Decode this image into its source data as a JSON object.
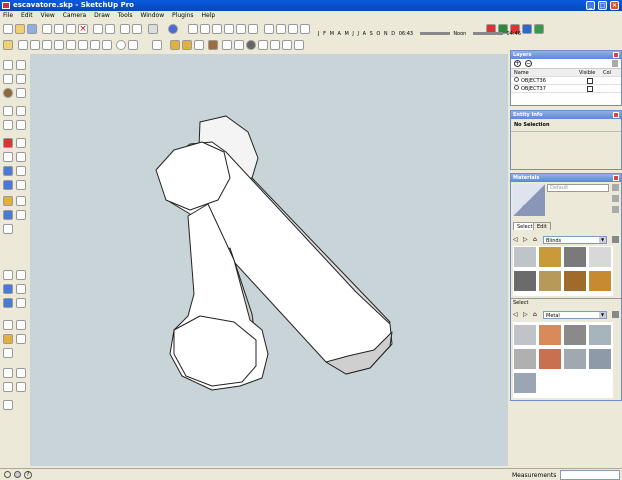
{
  "window": {
    "title": "escavatore.skp - SketchUp Pro"
  },
  "menu": [
    "File",
    "Edit",
    "View",
    "Camera",
    "Draw",
    "Tools",
    "Window",
    "Plugins",
    "Help"
  ],
  "timeline": {
    "months": [
      "J",
      "F",
      "M",
      "A",
      "M",
      "J",
      "J",
      "A",
      "S",
      "O",
      "N",
      "D"
    ],
    "time_start": "06:43",
    "noon": "Noon",
    "time_end": "04:46"
  },
  "layers": {
    "title": "Layers",
    "columns": [
      "Name",
      "Visible",
      "Col"
    ],
    "rows": [
      {
        "name": "OBJECT36"
      },
      {
        "name": "OBJECT37"
      }
    ]
  },
  "entity_info": {
    "title": "Entity Info",
    "value": "No Selection"
  },
  "materials": {
    "title": "Materials",
    "preview_label": "Default",
    "tabs": [
      "Select",
      "Edit"
    ],
    "library1": "Blinds",
    "select_label": "Select",
    "library2": "Metal",
    "colors1": [
      "#bfc4c8",
      "#c99a3a",
      "#7a7a7a",
      "#d8d8d8",
      "#6b6b6b",
      "#b79a5a",
      "#a06a2a",
      "#c88a30"
    ],
    "colors2": [
      "#c0c4c8",
      "#d88a5a",
      "#8a8a8a",
      "#a8b4bc",
      "#b0b0b0",
      "#c87050",
      "#a0a8b0",
      "#8e9aa8",
      "#9aa6b4"
    ]
  },
  "status": {
    "measurements_label": "Measurements"
  },
  "colors": {
    "viewport_bg": "#c8d4d8",
    "model_fill": "#ffffff",
    "model_shade": "#d0d0d0"
  }
}
